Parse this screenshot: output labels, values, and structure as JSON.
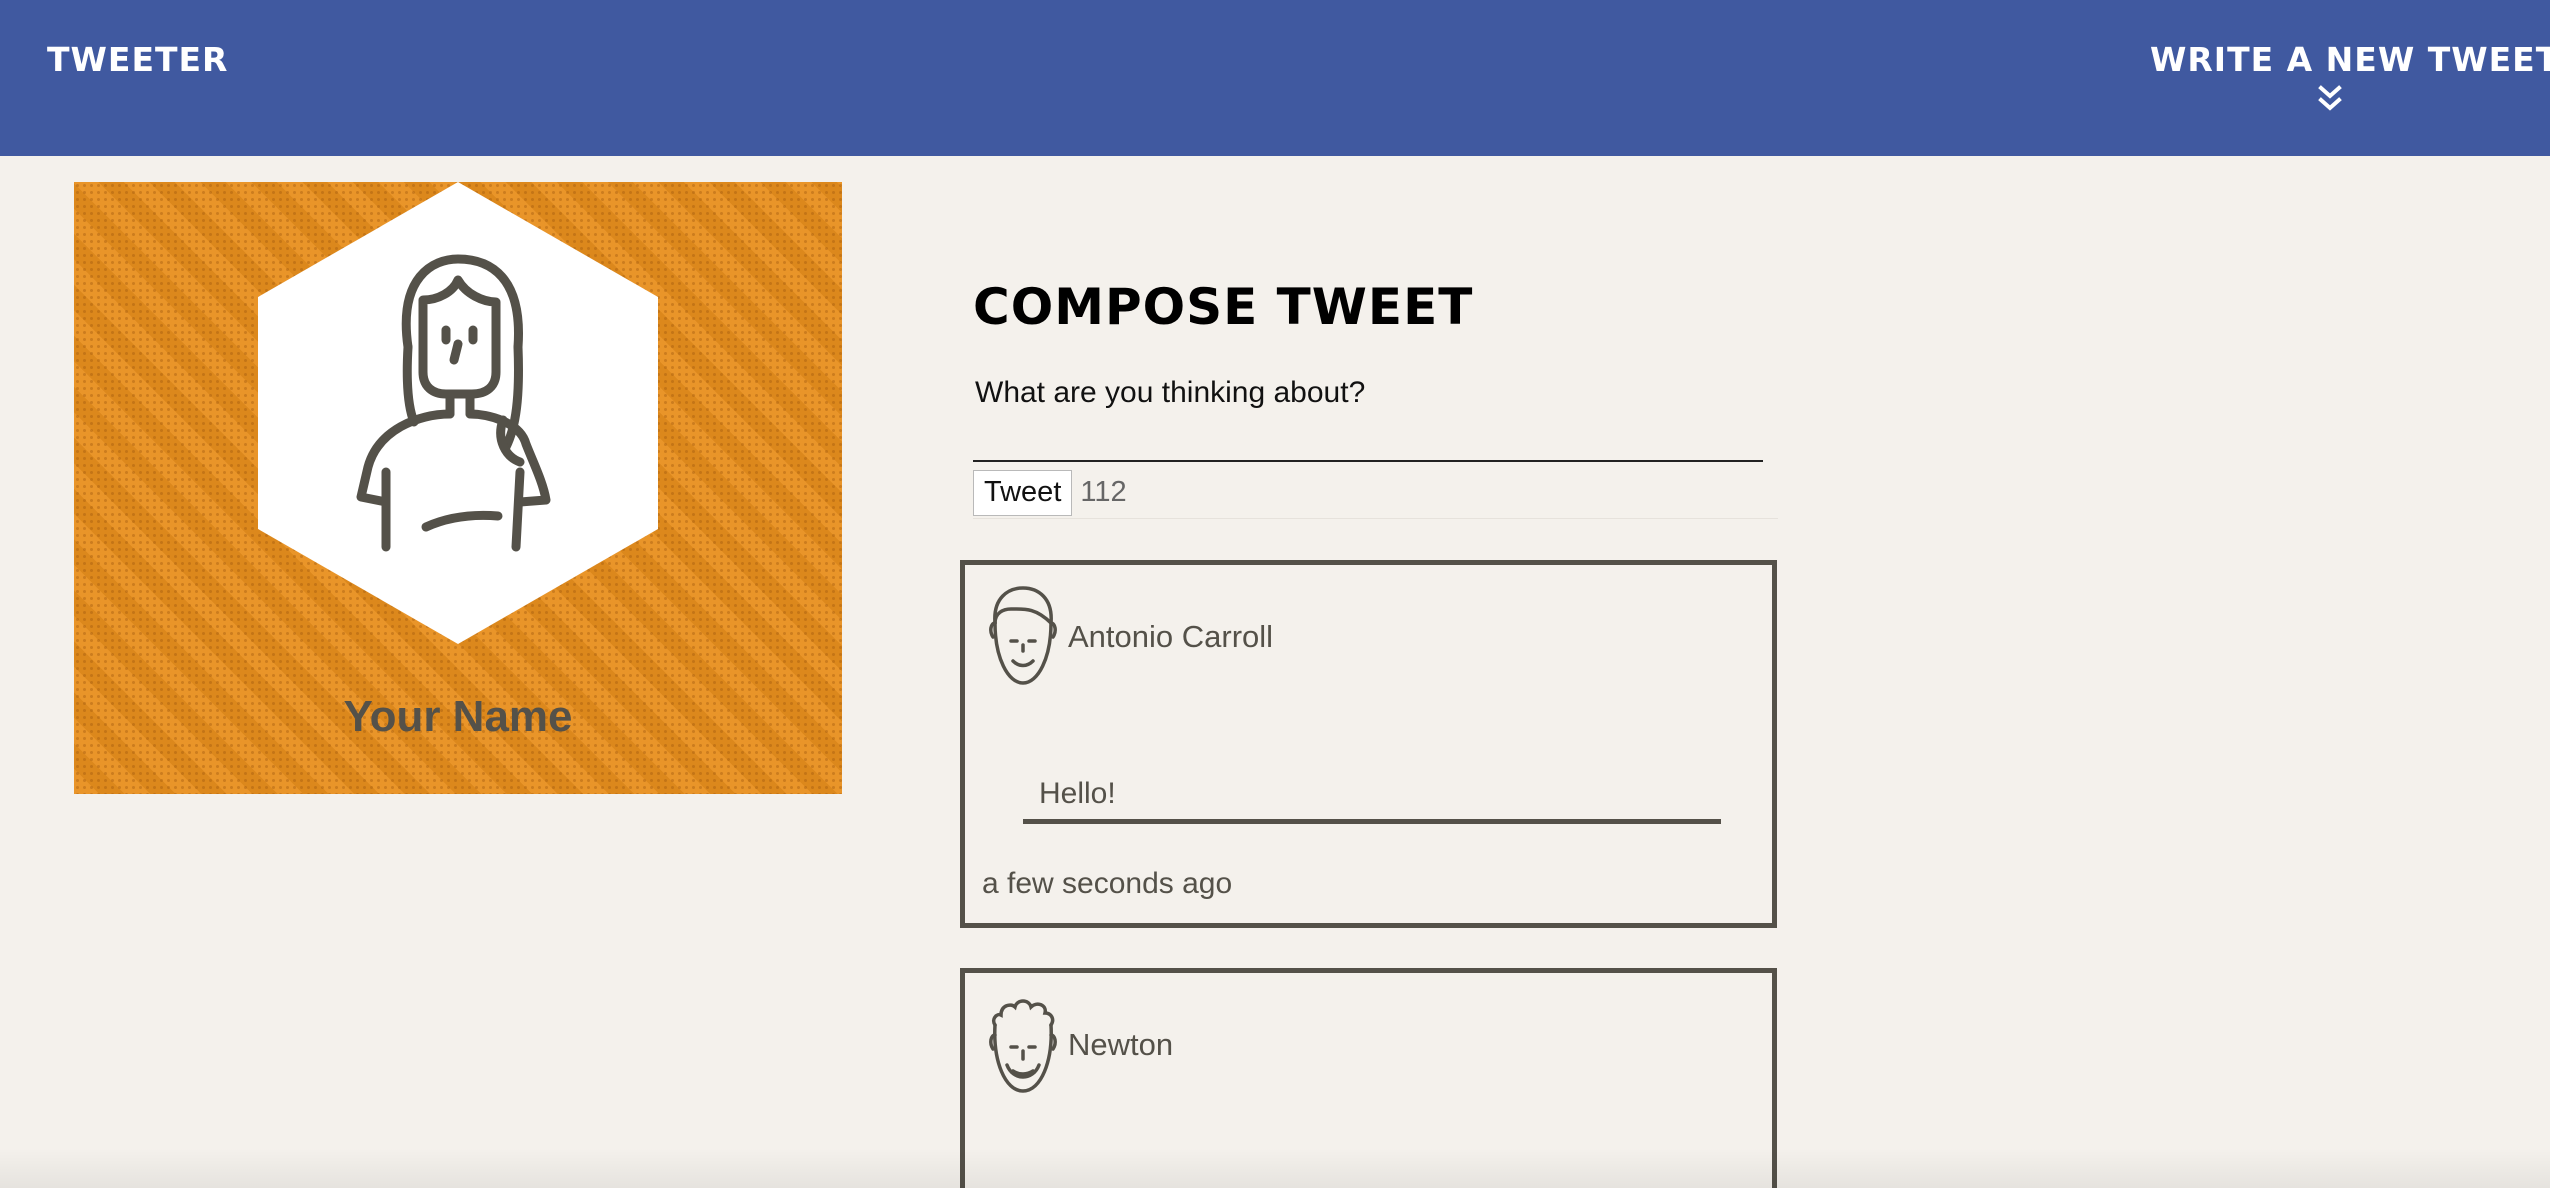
{
  "nav": {
    "brand": "TWEETER",
    "compose_link": "WRITE A NEW TWEET",
    "compose_link_icon": "double-chevron-down-icon"
  },
  "profile": {
    "name": "Your Name",
    "avatar_icon": "woman-avatar-icon",
    "background_color": "#e88f1e"
  },
  "compose": {
    "title": "COMPOSE TWEET",
    "placeholder": "What are you thinking about?",
    "button_label": "Tweet",
    "char_count": "112"
  },
  "tweets": [
    {
      "author": "Antonio Carroll",
      "avatar_icon": "man-avatar-icon",
      "text": "Hello!",
      "time": "a few seconds ago"
    },
    {
      "author": "Newton",
      "avatar_icon": "curly-hair-avatar-icon"
    }
  ],
  "colors": {
    "nav": "#4059a0",
    "page": "#f4f1ec",
    "text": "#545149"
  }
}
